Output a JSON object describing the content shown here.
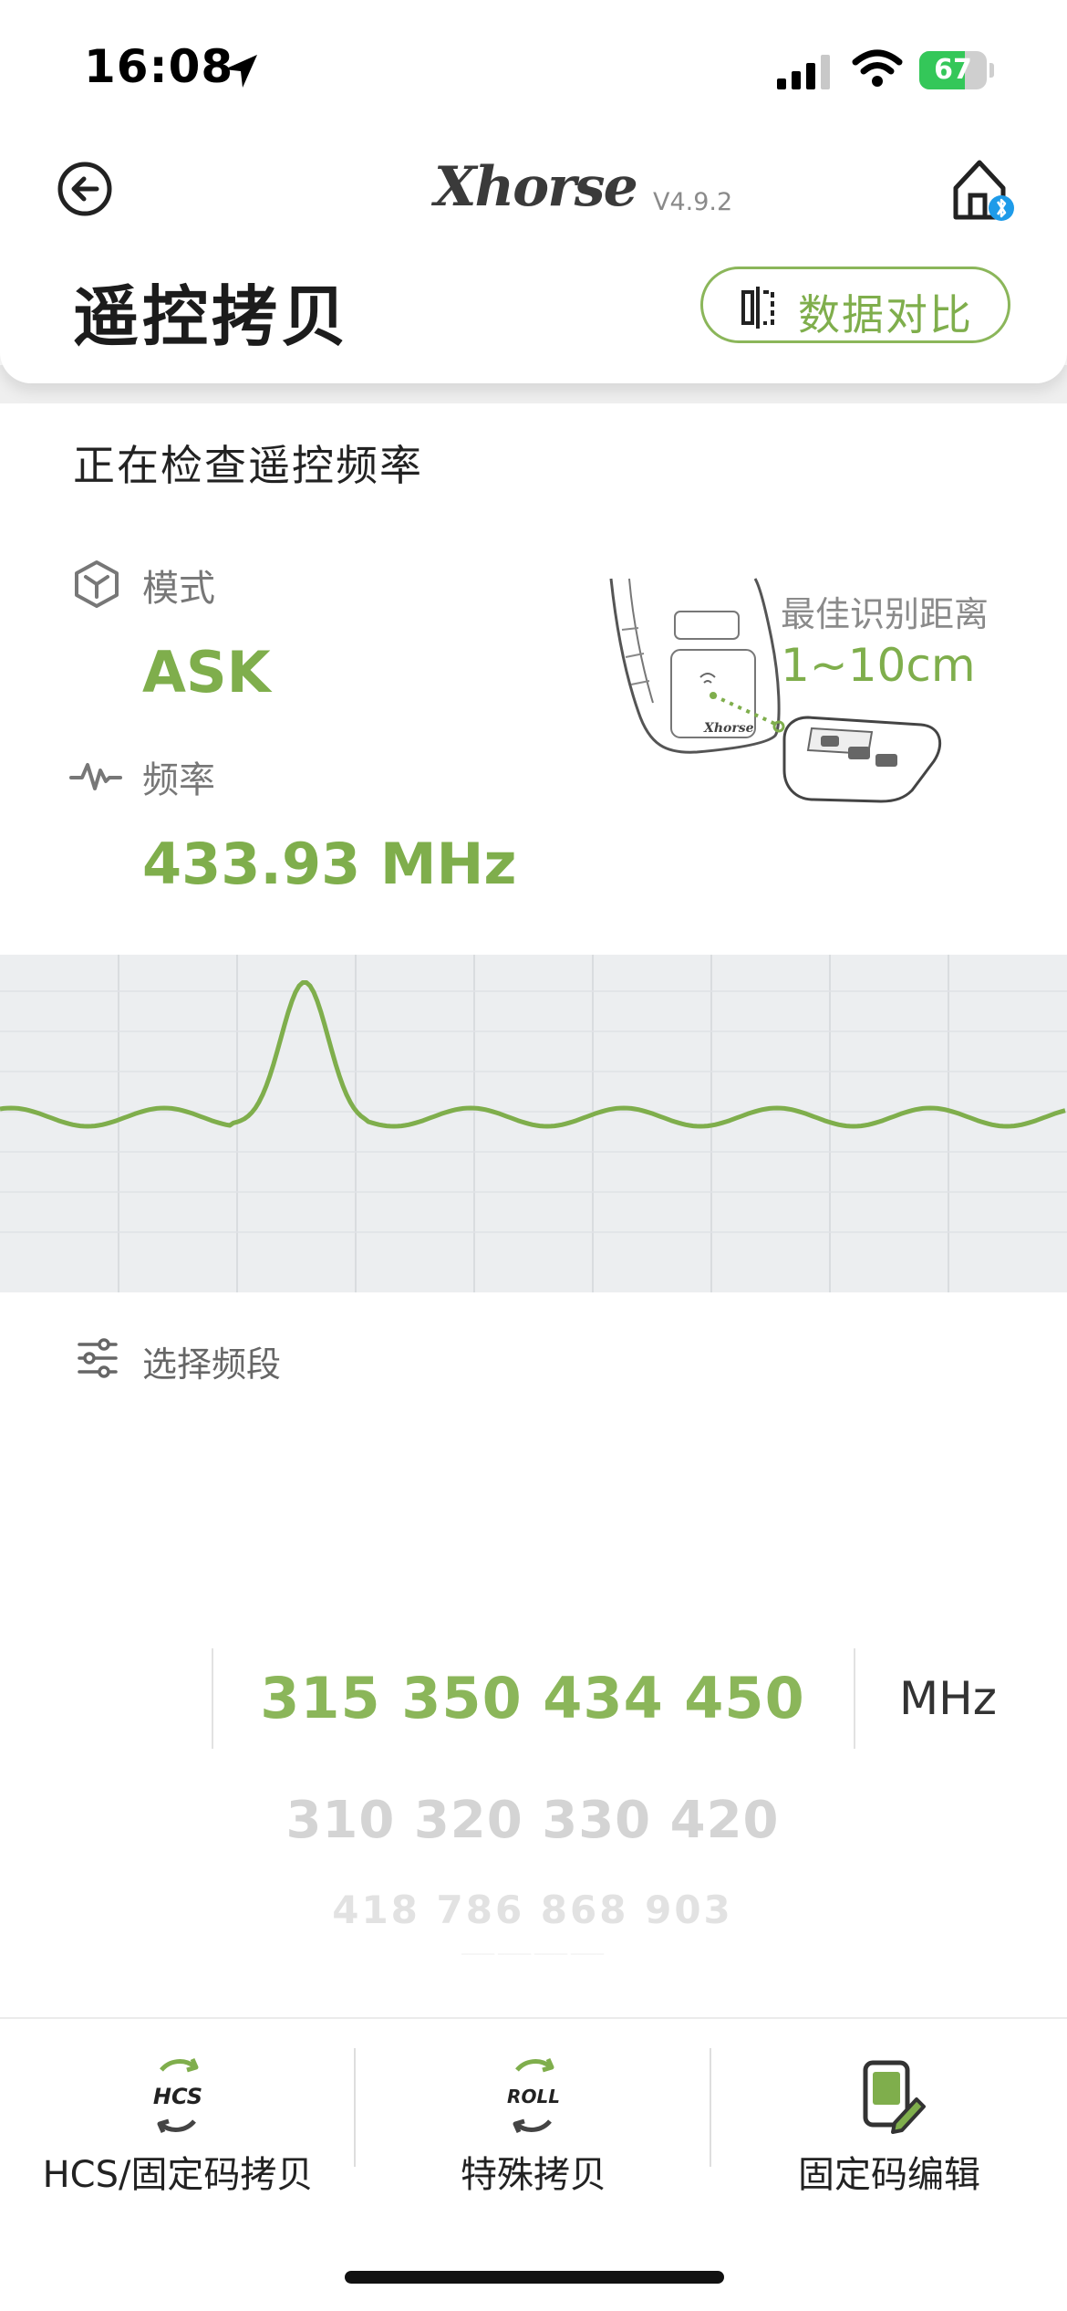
{
  "status_bar": {
    "time": "16:08",
    "battery_level": "67",
    "battery_percent": 67
  },
  "header": {
    "brand": "Xhorse",
    "version": "V4.9.2",
    "title": "遥控拷贝",
    "compare_label": "数据对比",
    "accent_color": "#7fae4c"
  },
  "detection": {
    "status": "正在检查遥控频率",
    "mode_label": "模式",
    "mode_value": "ASK",
    "freq_label": "频率",
    "freq_value": "433.93 MHz",
    "distance_label": "最佳识别距离",
    "distance_value": "1~10cm"
  },
  "band_select": {
    "label": "选择频段",
    "unit": "MHz",
    "rows": [
      "315 350 434 450",
      "310 320 330 420",
      "418 786 868 903",
      "───── ───── ───── ─────"
    ]
  },
  "bottom_nav": {
    "items": [
      {
        "label": "HCS/固定码拷贝",
        "icon": "hcs-icon",
        "icon_text": "HCS"
      },
      {
        "label": "特殊拷贝",
        "icon": "roll-icon",
        "icon_text": "ROLL"
      },
      {
        "label": "固定码编辑",
        "icon": "edit-code-icon"
      }
    ]
  }
}
